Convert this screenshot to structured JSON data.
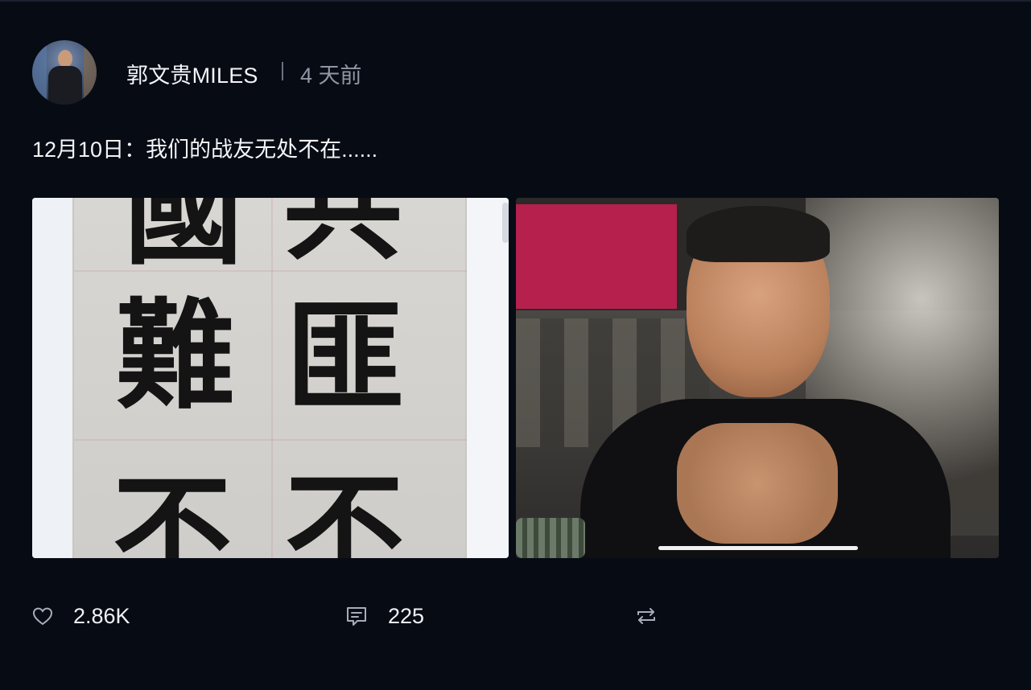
{
  "post": {
    "author": "郭文贵MILES",
    "time": "4 天前",
    "text": "12月10日：我们的战友无处不在......",
    "media": {
      "left_image": {
        "type": "calligraphy",
        "glyphs_visible": [
          "國",
          "共",
          "難",
          "匪",
          "不",
          "不"
        ]
      },
      "right_image": {
        "type": "video-still",
        "progress": 0.0
      }
    },
    "actions": {
      "like": {
        "icon": "heart-icon",
        "count": "2.86K"
      },
      "comment": {
        "icon": "comment-icon",
        "count": "225"
      },
      "repost": {
        "icon": "repost-icon",
        "count": ""
      }
    }
  },
  "colors": {
    "background": "#070b14",
    "text_primary": "#f3f5f9",
    "text_secondary": "#9197a3"
  }
}
